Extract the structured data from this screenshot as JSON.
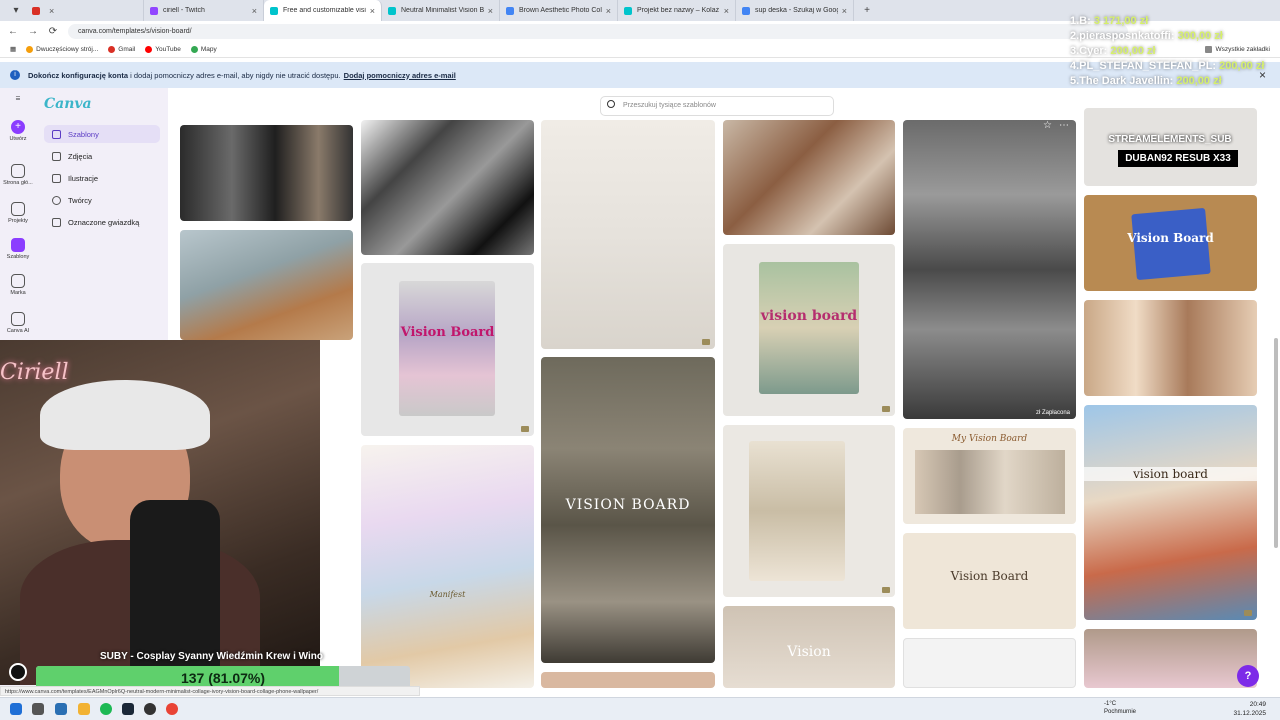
{
  "browser": {
    "tabs": [
      {
        "label": "ciriell - Twitch",
        "color": "#9146ff"
      },
      {
        "label": "Free and customizable vision b",
        "color": "#00c4cc"
      },
      {
        "label": "Neutral Minimalist Vision Boar",
        "color": "#00c4cc"
      },
      {
        "label": "Brown Aesthetic Photo Collage",
        "color": "#4285f4"
      },
      {
        "label": "Projekt bez nazwy – Kolaż ze zd",
        "color": "#00c4cc"
      },
      {
        "label": "sup deska - Szukaj w Google",
        "color": "#4285f4"
      }
    ],
    "url": "canva.com/templates/s/vision-board/",
    "bookmarks": [
      "Dwuczęściowy strój...",
      "Gmail",
      "YouTube",
      "Mapy"
    ],
    "all_bookmarks": "Wszystkie zakładki"
  },
  "banner": {
    "text_bold": "Dokończ konfigurację konta",
    "text": " i dodaj pomocniczy adres e-mail, aby nigdy nie utracić dostępu.",
    "link": "Dodaj pomocniczy adres e-mail"
  },
  "canva": {
    "logo": "Canva",
    "rail": [
      "Utwórz",
      "Strona głó...",
      "Projekty",
      "Szablony",
      "Marka",
      "Canva AI"
    ],
    "panel": [
      "Szablony",
      "Zdjęcia",
      "Ilustracje",
      "Twórcy",
      "Oznaczone gwiazdką"
    ],
    "search_placeholder": "Przeszukuj tysiące szablonów",
    "card_labels": {
      "vision_board": "Vision Board",
      "vision_board_lower": "vision board",
      "my_vision_board": "My Vision Board",
      "vision": "Vision",
      "vision_2030": "VISION BOARD",
      "paid": "zł Zapłacona",
      "manifest": "Manifest"
    }
  },
  "overlay": {
    "ranking": [
      {
        "name": "1.B:",
        "amount": "3 171,00 zł"
      },
      {
        "name": "2.pierasposnkatoffi:",
        "amount": "300,00 zł"
      },
      {
        "name": "3.Cyer:",
        "amount": "200,00 zł"
      },
      {
        "name": "4.PL_STEFAN_STEFAN_PL:",
        "amount": "200,00 zł"
      },
      {
        "name": "5.The Dark Javellin:",
        "amount": "200,00 zł"
      }
    ],
    "sub_banner_1": "STREAMELEMENTS_SUB",
    "sub_banner_2": "DUBAN92  RESUB X33",
    "alert_name": "SUBY - Cosplay Syanny Wiedźmin Krew i Wino",
    "goal_text": "137 (81.07%)",
    "goal_percent": 81.07,
    "webcam_sign": "Ciriell"
  },
  "status_url": "https://www.canva.com/templates/EAGMnOplr6Q-neutral-modern-minimalist-collage-ivory-vision-board-collage-phone-wallpaper/",
  "taskbar": {
    "weather_temp": "-1°C",
    "weather_desc": "Pochmurnie",
    "time": "20:49",
    "date": "31.12.2025"
  }
}
